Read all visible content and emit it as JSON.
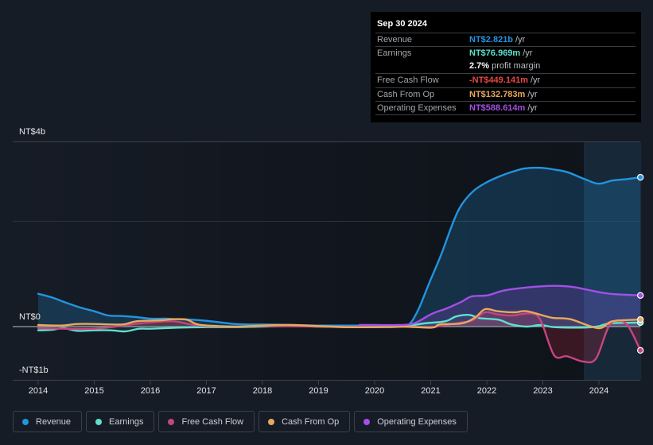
{
  "tooltip": {
    "date": "Sep 30 2024",
    "rows": [
      {
        "label": "Revenue",
        "value": "NT$2.821b",
        "unit": "/yr",
        "color": "#2394df"
      },
      {
        "label": "Earnings",
        "value": "NT$76.969m",
        "unit": "/yr",
        "color": "#5ee0cd"
      },
      {
        "label": "",
        "value": "2.7%",
        "unit": "profit margin",
        "color": "#ffffff"
      },
      {
        "label": "Free Cash Flow",
        "value": "-NT$449.141m",
        "unit": "/yr",
        "color": "#e84545"
      },
      {
        "label": "Cash From Op",
        "value": "NT$132.783m",
        "unit": "/yr",
        "color": "#e8a95b"
      },
      {
        "label": "Operating Expenses",
        "value": "NT$588.614m",
        "unit": "/yr",
        "color": "#a54ee8"
      }
    ]
  },
  "legend": [
    {
      "label": "Revenue",
      "color": "#2394df"
    },
    {
      "label": "Earnings",
      "color": "#5ee0cd"
    },
    {
      "label": "Free Cash Flow",
      "color": "#c4457f"
    },
    {
      "label": "Cash From Op",
      "color": "#e8a95b"
    },
    {
      "label": "Operating Expenses",
      "color": "#a54ee8"
    }
  ],
  "chart_data": {
    "type": "area",
    "title": "",
    "xlabel": "",
    "ylabel": "",
    "y_tick_labels": [
      "NT$4b",
      "NT$0",
      "-NT$1b"
    ],
    "x_tick_labels": [
      "2014",
      "2015",
      "2016",
      "2017",
      "2018",
      "2019",
      "2020",
      "2021",
      "2022",
      "2023",
      "2024"
    ],
    "x_ticks": [
      2014,
      2015,
      2016,
      2017,
      2018,
      2019,
      2020,
      2021,
      2022,
      2023,
      2024
    ],
    "xlim": [
      2014,
      2024.74
    ],
    "ylim_billions": [
      -1,
      3.5
    ],
    "units": "NT$ billions",
    "highlight_period": [
      2023.73,
      2024.74
    ],
    "grid": true,
    "legend_position": "bottom",
    "series": [
      {
        "name": "Revenue",
        "key": "revenue",
        "color": "#2394df",
        "fill": "rgba(35,148,223,0.22)",
        "x": [
          2014.0,
          2014.25,
          2014.5,
          2014.75,
          2015.0,
          2015.25,
          2015.5,
          2015.75,
          2016.0,
          2016.25,
          2016.5,
          2016.75,
          2017.0,
          2017.25,
          2017.5,
          2017.75,
          2018.0,
          2018.5,
          2019.0,
          2019.5,
          2020.0,
          2020.4,
          2020.6,
          2020.77,
          2020.98,
          2021.19,
          2021.4,
          2021.55,
          2021.76,
          2021.97,
          2022.23,
          2022.47,
          2022.68,
          2022.96,
          2023.25,
          2023.46,
          2023.74,
          2023.99,
          2024.24,
          2024.52,
          2024.74
        ],
        "values": [
          0.62,
          0.55,
          0.45,
          0.36,
          0.29,
          0.21,
          0.2,
          0.18,
          0.15,
          0.15,
          0.14,
          0.13,
          0.11,
          0.08,
          0.05,
          0.04,
          0.04,
          0.03,
          0.02,
          0.02,
          0.02,
          0.02,
          0.03,
          0.3,
          0.84,
          1.37,
          1.97,
          2.3,
          2.56,
          2.71,
          2.84,
          2.93,
          2.99,
          3.0,
          2.96,
          2.91,
          2.79,
          2.7,
          2.76,
          2.79,
          2.821
        ]
      },
      {
        "name": "Earnings",
        "key": "earnings",
        "color": "#5ee0cd",
        "fill": "rgba(94,224,205,0.08)",
        "x": [
          2014.0,
          2014.25,
          2014.45,
          2014.7,
          2015.0,
          2015.3,
          2015.55,
          2015.8,
          2016.0,
          2016.5,
          2017.0,
          2017.5,
          2018.0,
          2018.5,
          2019.0,
          2019.5,
          2020.0,
          2020.5,
          2020.88,
          2021.26,
          2021.45,
          2021.69,
          2021.87,
          2022.21,
          2022.44,
          2022.72,
          2022.96,
          2023.2,
          2023.67,
          2023.96,
          2024.2,
          2024.74
        ],
        "values": [
          -0.07,
          -0.06,
          -0.03,
          -0.08,
          -0.07,
          -0.07,
          -0.09,
          -0.04,
          -0.04,
          -0.02,
          -0.01,
          -0.01,
          0.0,
          0.01,
          0.0,
          -0.01,
          -0.01,
          0.0,
          0.06,
          0.1,
          0.19,
          0.22,
          0.16,
          0.13,
          0.04,
          0.0,
          0.03,
          -0.01,
          -0.02,
          0.0,
          0.06,
          0.077
        ]
      },
      {
        "name": "Free Cash Flow",
        "key": "fcf",
        "color": "#c4457f",
        "fill": "rgba(170,40,60,0.28)",
        "x": [
          2014.0,
          2015.0,
          2015.8,
          2016.4,
          2016.85,
          2017.5,
          2018.0,
          2019.0,
          2020.0,
          2020.5,
          2021.0,
          2021.5,
          2021.75,
          2021.97,
          2022.2,
          2022.45,
          2022.78,
          2022.96,
          2023.2,
          2023.43,
          2023.72,
          2023.95,
          2024.2,
          2024.48,
          2024.74
        ],
        "values": [
          -0.03,
          -0.04,
          0.06,
          0.1,
          0.02,
          0.0,
          0.01,
          0.0,
          -0.01,
          0.0,
          -0.01,
          0.07,
          0.12,
          0.27,
          0.23,
          0.21,
          0.25,
          0.12,
          -0.54,
          -0.56,
          -0.66,
          -0.6,
          0.04,
          0.06,
          -0.449
        ]
      },
      {
        "name": "Cash From Op",
        "key": "cfo",
        "color": "#e8a95b",
        "fill": "rgba(232,169,91,0.1)",
        "x": [
          2014.0,
          2014.4,
          2014.7,
          2015.0,
          2015.5,
          2015.75,
          2016.2,
          2016.4,
          2016.65,
          2016.85,
          2017.2,
          2017.6,
          2018.0,
          2018.5,
          2019.0,
          2019.5,
          2020.0,
          2020.5,
          2021.02,
          2021.16,
          2021.55,
          2021.79,
          2021.97,
          2022.2,
          2022.5,
          2022.72,
          2023.15,
          2023.49,
          2023.99,
          2024.24,
          2024.74
        ],
        "values": [
          0.03,
          0.02,
          0.05,
          0.05,
          0.04,
          0.1,
          0.12,
          0.14,
          0.13,
          0.04,
          0.01,
          0.0,
          0.02,
          0.03,
          0.01,
          -0.01,
          -0.01,
          0.0,
          -0.02,
          0.04,
          0.06,
          0.17,
          0.33,
          0.29,
          0.27,
          0.29,
          0.17,
          0.14,
          -0.03,
          0.1,
          0.133
        ]
      },
      {
        "name": "Operating Expenses",
        "key": "opex",
        "color": "#a54ee8",
        "fill": "rgba(165,78,232,0.22)",
        "x": [
          2019.73,
          2020.0,
          2020.41,
          2020.7,
          2021.02,
          2021.3,
          2021.55,
          2021.73,
          2022.01,
          2022.3,
          2022.72,
          2023.2,
          2023.53,
          2023.82,
          2024.2,
          2024.74
        ],
        "values": [
          0.03,
          0.03,
          0.03,
          0.06,
          0.24,
          0.35,
          0.47,
          0.57,
          0.59,
          0.68,
          0.74,
          0.77,
          0.75,
          0.69,
          0.62,
          0.589
        ]
      }
    ]
  }
}
